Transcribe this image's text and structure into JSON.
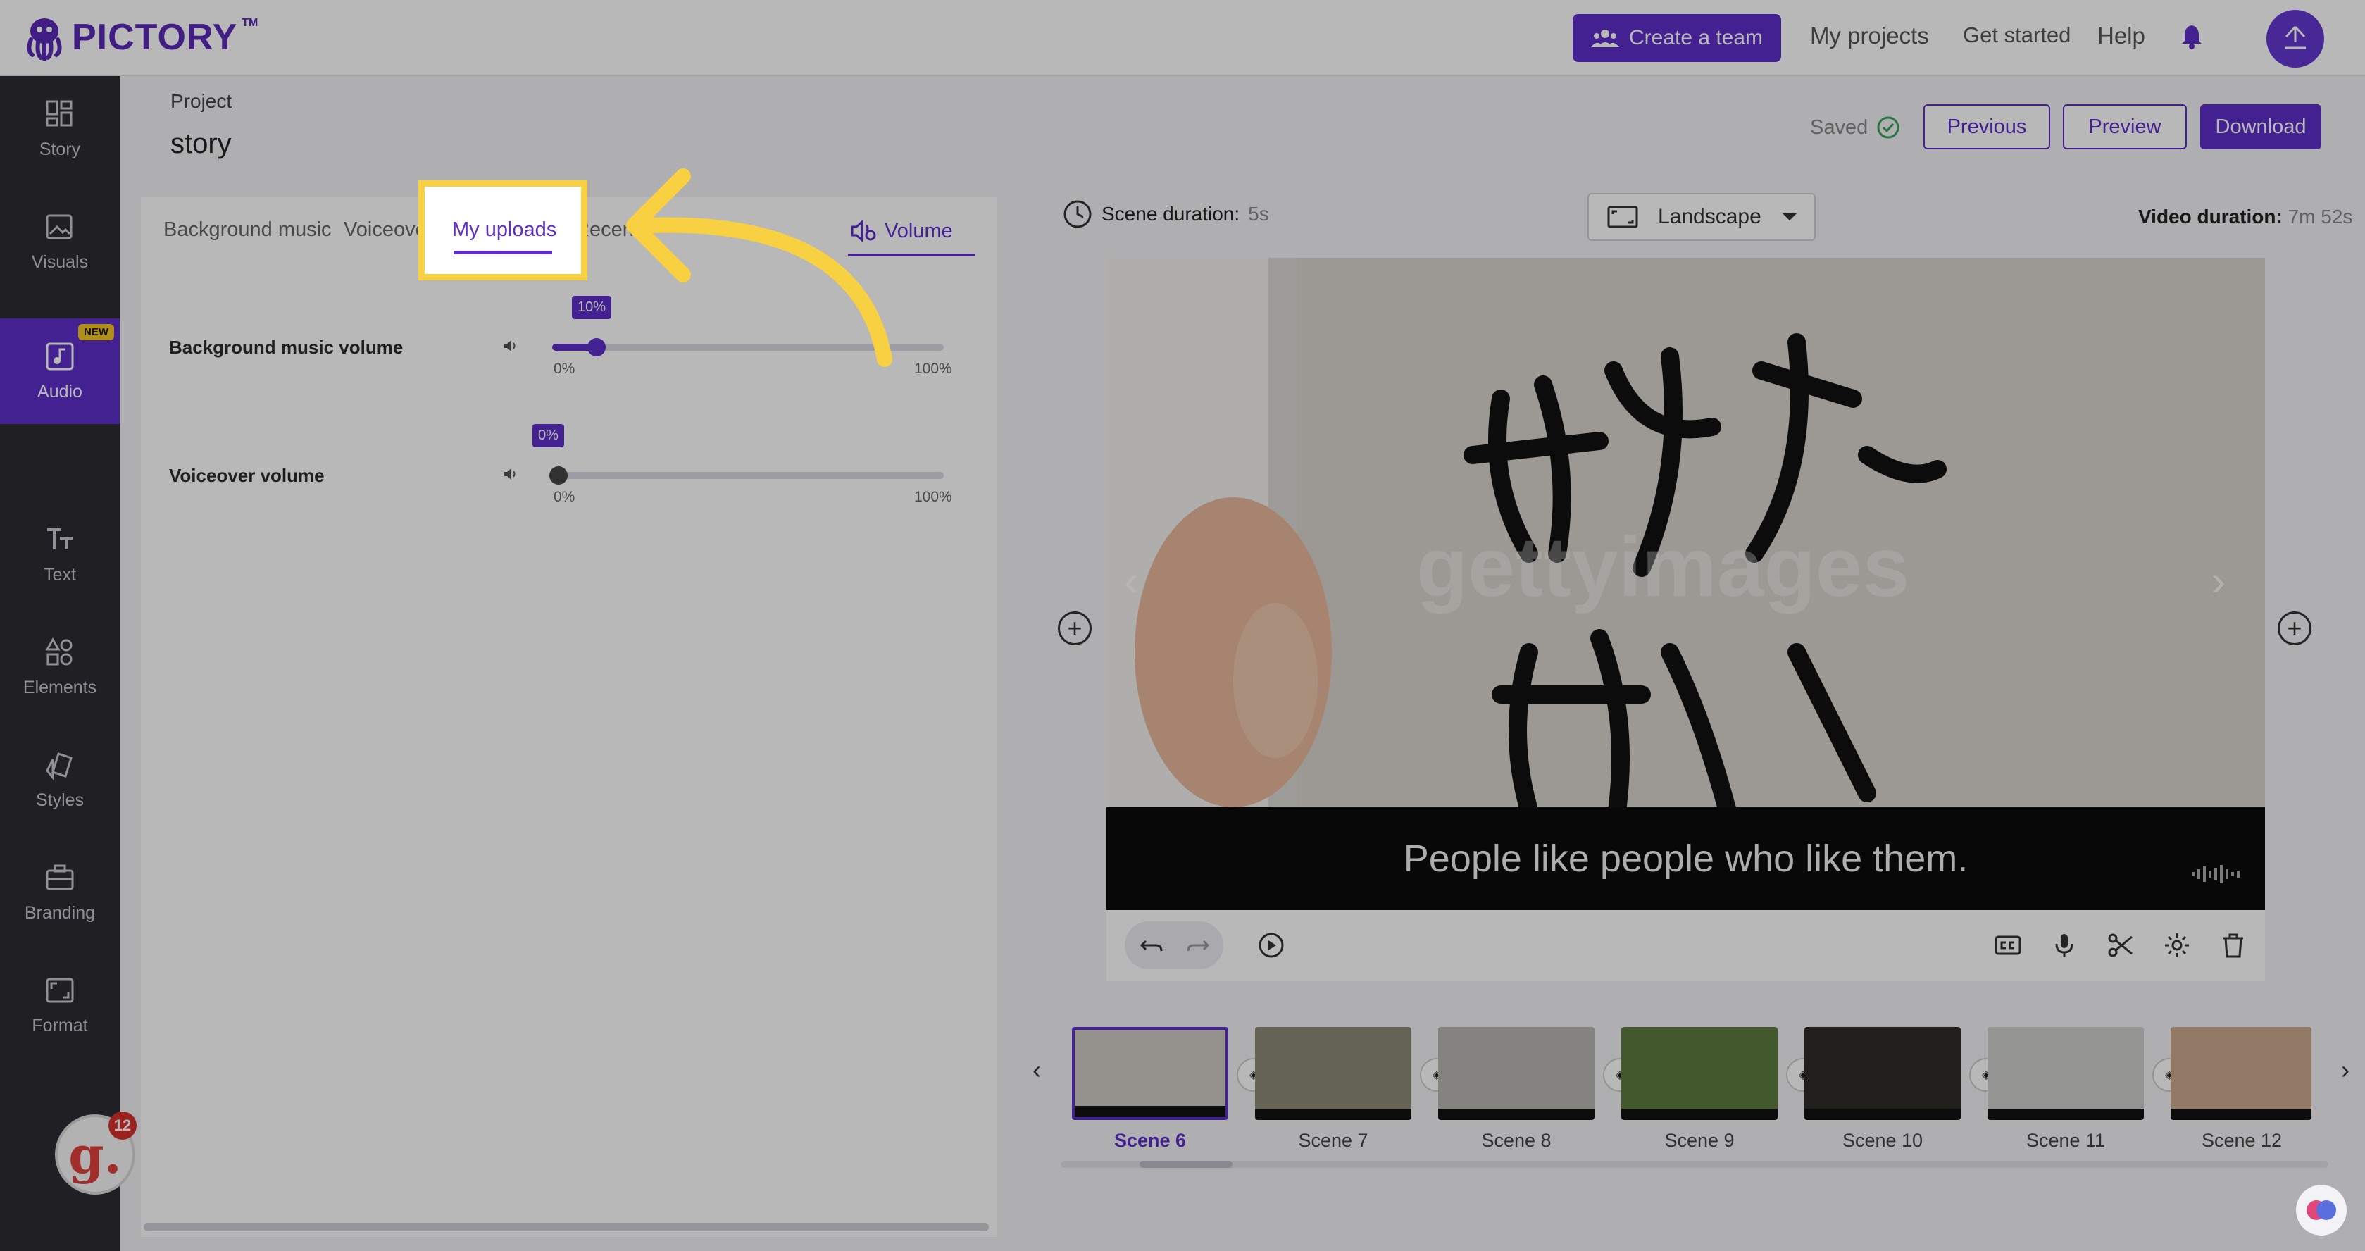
{
  "brand": {
    "name": "PICTORY",
    "tm": "TM",
    "accent": "#5f2ec9",
    "highlight": "#f8d142"
  },
  "topbar": {
    "create_team": "Create a team",
    "my_projects": "My projects",
    "get_started": "Get started",
    "help": "Help"
  },
  "sidebar": {
    "items": [
      {
        "label": "Story",
        "icon": "grid-icon"
      },
      {
        "label": "Visuals",
        "icon": "image-icon"
      },
      {
        "label": "Audio",
        "icon": "music-note-icon",
        "badge": "NEW",
        "active": true
      },
      {
        "label": "Text",
        "icon": "text-icon"
      },
      {
        "label": "Elements",
        "icon": "shapes-icon"
      },
      {
        "label": "Styles",
        "icon": "brush-icon"
      },
      {
        "label": "Branding",
        "icon": "briefcase-icon"
      },
      {
        "label": "Format",
        "icon": "aspect-ratio-icon"
      }
    ],
    "grammarly_letter": "g.",
    "grammarly_count": "12"
  },
  "project": {
    "label": "Project",
    "name": "story",
    "saved": "Saved",
    "previous": "Previous",
    "preview": "Preview",
    "download": "Download"
  },
  "audio_panel": {
    "tabs": [
      "Background music",
      "Voiceover",
      "My uploads",
      "Recen"
    ],
    "volume_tab": "Volume",
    "rows": [
      {
        "label": "Background music volume",
        "value": 10,
        "tip": "10%",
        "min": "0%",
        "max": "100%"
      },
      {
        "label": "Voiceover volume",
        "value": 0,
        "tip": "0%",
        "min": "0%",
        "max": "100%"
      }
    ]
  },
  "editor": {
    "scene_duration_label": "Scene duration:",
    "scene_duration_value": "5s",
    "orientation": "Landscape",
    "video_duration_label": "Video duration:",
    "video_duration_value": "7m 52s",
    "caption": "People like people who like them.",
    "watermark": "gettyimages"
  },
  "scenes": [
    {
      "label": "Scene 6",
      "selected": true
    },
    {
      "label": "Scene 7"
    },
    {
      "label": "Scene 8"
    },
    {
      "label": "Scene 9"
    },
    {
      "label": "Scene 10"
    },
    {
      "label": "Scene 11"
    },
    {
      "label": "Scene 12"
    }
  ]
}
